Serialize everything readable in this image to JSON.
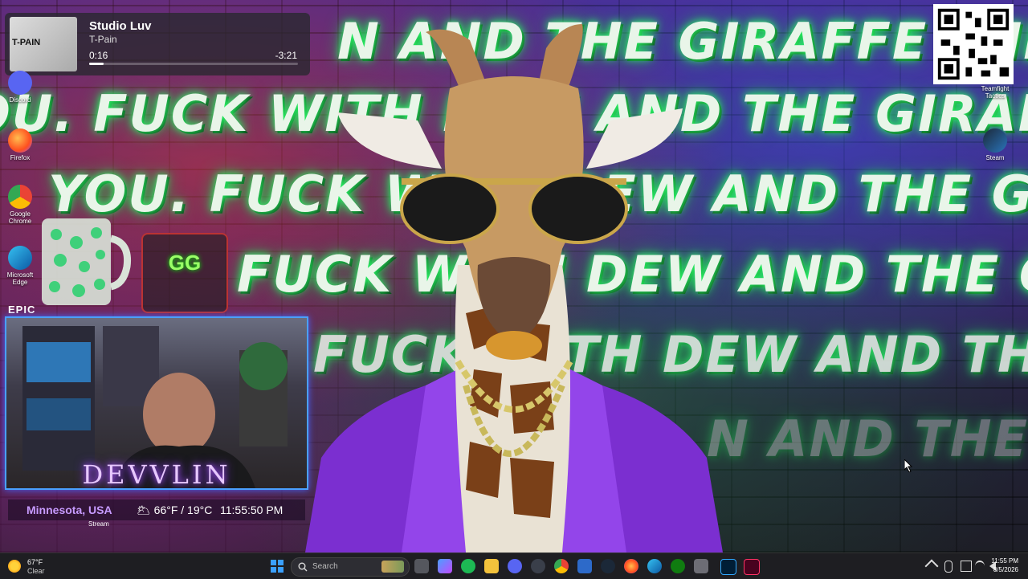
{
  "media": {
    "title": "Studio Luv",
    "artist": "T-Pain",
    "album_tag": "T-PAIN",
    "elapsed": "0:16",
    "remaining": "-3:21",
    "progress": 0.07
  },
  "wallpaper": {
    "lines": [
      "N AND THE GIRAFFE WILL FIND",
      "OU. FUCK WITH DEW AND THE GIRAFFE WILL FIND Y",
      "YOU. FUCK WITH DEW AND THE GIRAFFE WILL FIN",
      "FUCK WITH DEW AND THE GIRAFFE WIL",
      "FUCK WITH DEW AND THE GIRAFFE",
      "N AND THE GIRA"
    ]
  },
  "desktop_icons": {
    "discord": "Discord",
    "firefox": "Firefox",
    "chrome": "Google Chrome",
    "edge": "Microsoft Edge",
    "teamfight": "Teamfight Tactics",
    "steam": "Steam"
  },
  "badge_text": "GG",
  "epic_label": "EPIC",
  "webcam": {
    "name": "DEVVLIN"
  },
  "weather_overlay": {
    "location": "Minnesota, USA",
    "temp": "🌥 66°F / 19°C",
    "time": "11:55:50 PM",
    "stream_label": "Stream"
  },
  "taskbar": {
    "weather_temp": "67°F",
    "weather_cond": "Clear",
    "search_placeholder": "Search",
    "clock_time": "11:55 PM",
    "clock_date": "8/5/2026"
  },
  "colors": {
    "accent_green": "#2cff6a",
    "suit_purple": "#7b2fd0",
    "taskbar_bg": "#1e1e22"
  }
}
